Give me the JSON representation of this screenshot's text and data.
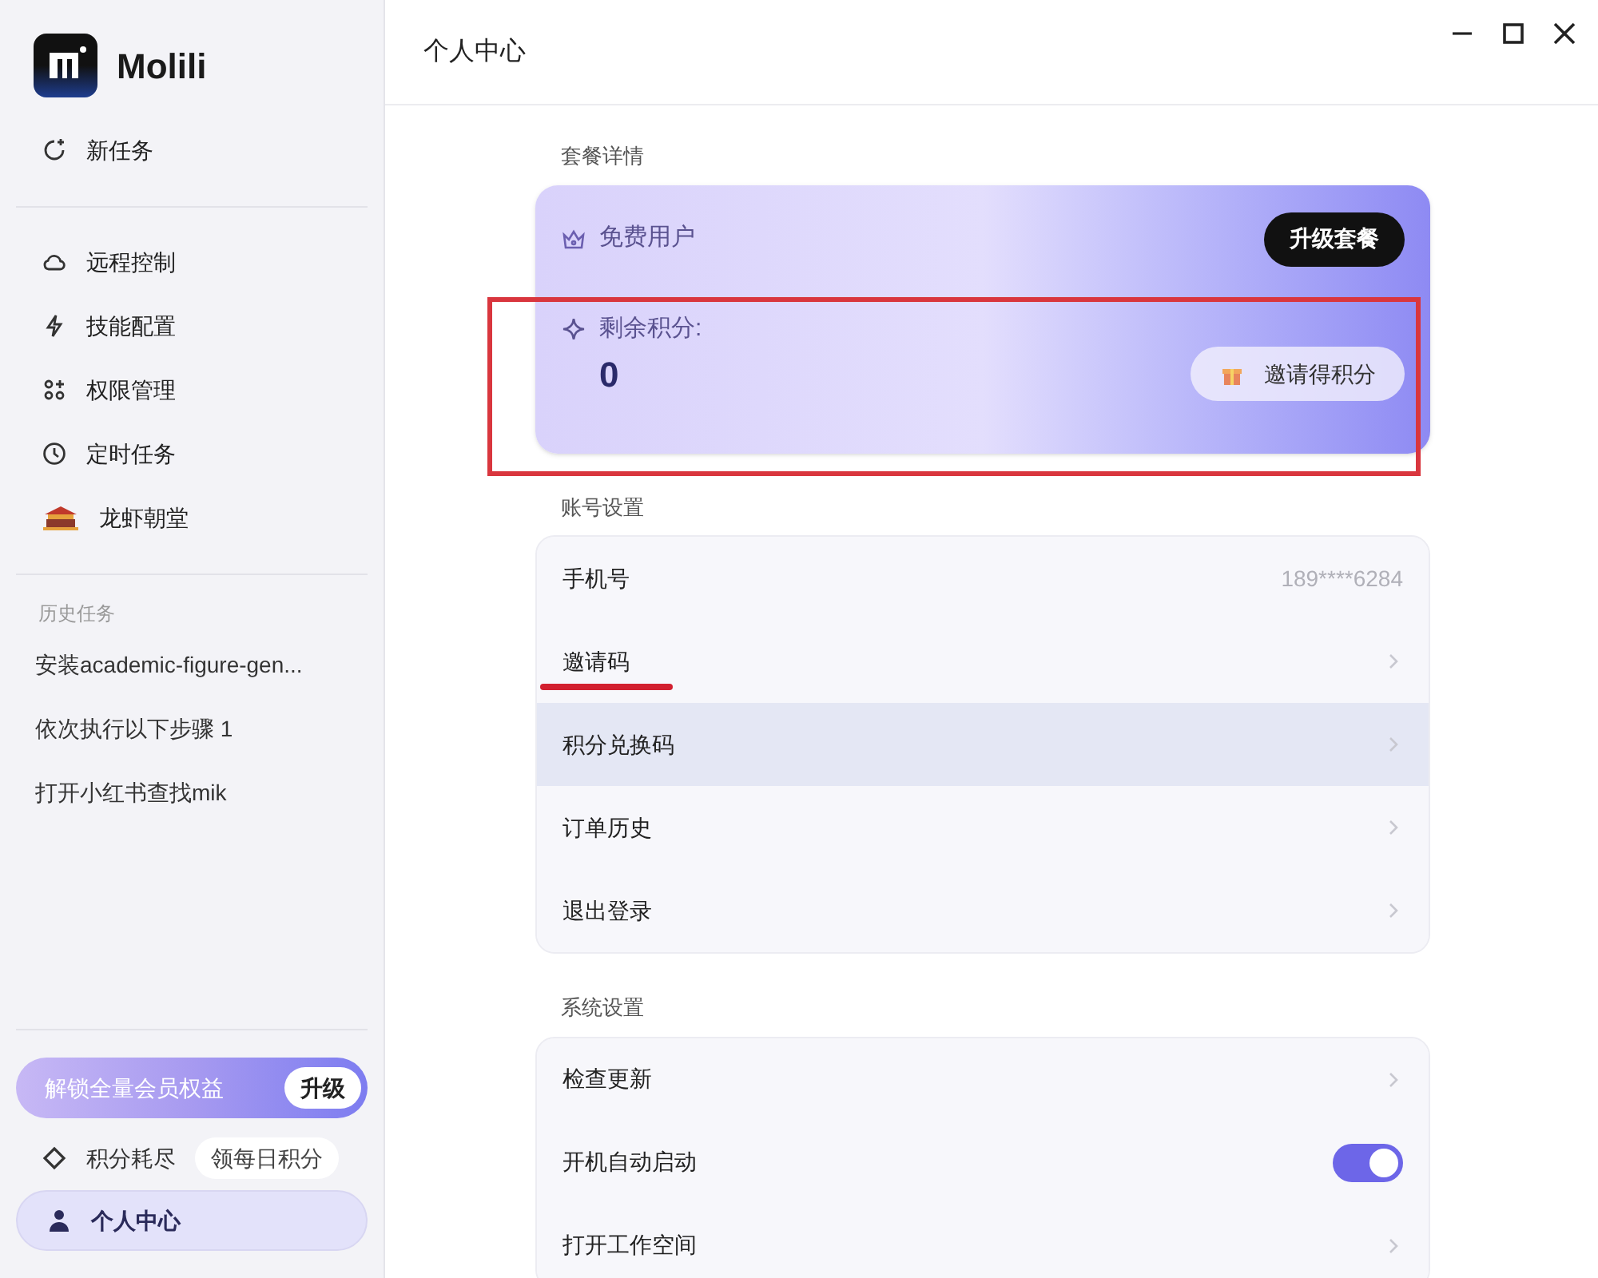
{
  "app": {
    "name": "Molili"
  },
  "sidebar": {
    "new_task": "新任务",
    "items": [
      {
        "label": "远程控制"
      },
      {
        "label": "技能配置"
      },
      {
        "label": "权限管理"
      },
      {
        "label": "定时任务"
      },
      {
        "label": "龙虾朝堂"
      }
    ],
    "history_title": "历史任务",
    "history": [
      "安装academic-figure-gen...",
      "依次执行以下步骤 1",
      "打开小红书查找mik"
    ],
    "upgrade_banner": {
      "text": "解锁全量会员权益",
      "button": "升级"
    },
    "points": {
      "status": "积分耗尽",
      "button": "领每日积分"
    },
    "profile": {
      "label": "个人中心",
      "selected": true
    }
  },
  "header": {
    "title": "个人中心"
  },
  "plan": {
    "section_title": "套餐详情",
    "tier": "免费用户",
    "upgrade_button": "升级套餐",
    "points_label": "剩余积分:",
    "points_value": "0",
    "invite_button": "邀请得积分"
  },
  "account": {
    "section_title": "账号设置",
    "rows": [
      {
        "label": "手机号",
        "kind": "value",
        "value": "189****6284",
        "hovered": false
      },
      {
        "label": "邀请码",
        "kind": "link",
        "hovered": false
      },
      {
        "label": "积分兑换码",
        "kind": "link",
        "hovered": true
      },
      {
        "label": "订单历史",
        "kind": "link",
        "hovered": false
      },
      {
        "label": "退出登录",
        "kind": "link",
        "hovered": false
      }
    ]
  },
  "system": {
    "section_title": "系统设置",
    "rows": [
      {
        "label": "检查更新",
        "kind": "link",
        "hovered": false
      },
      {
        "label": "开机自动启动",
        "kind": "toggle",
        "on": true,
        "hovered": false
      },
      {
        "label": "打开工作空间",
        "kind": "link",
        "hovered": false
      }
    ]
  }
}
